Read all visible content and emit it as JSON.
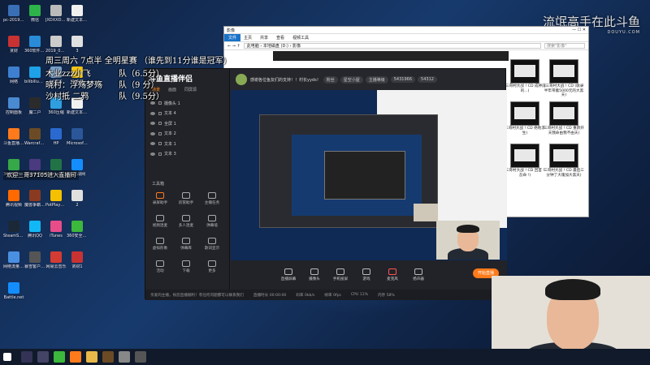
{
  "desktop_icons": [
    {
      "label": "pc-20190...",
      "color": "#3a6fb5"
    },
    {
      "label": "微信",
      "color": "#2db34a"
    },
    {
      "label": "JXDXXDR...",
      "color": "#bbbbbb"
    },
    {
      "label": "新建文本文档 (2)",
      "color": "#f0f0f0"
    },
    {
      "label": "贪财",
      "color": "#c83232"
    },
    {
      "label": "360软件管家",
      "color": "#2a8bd8"
    },
    {
      "label": "2019_06_1...",
      "color": "#cccccc"
    },
    {
      "label": "3",
      "color": "#e0e0e0"
    },
    {
      "label": "网络",
      "color": "#3f7fcf"
    },
    {
      "label": "bilibiliupl...",
      "color": "#1ea1e6"
    },
    {
      "label": "回收站",
      "color": "#7aa0c8"
    },
    {
      "label": "YY语音",
      "color": "#f2c316"
    },
    {
      "label": "控制面板",
      "color": "#4a8ad0"
    },
    {
      "label": "魔二户",
      "color": "#2b2b2b"
    },
    {
      "label": "360压缩",
      "color": "#2f9fe0"
    },
    {
      "label": "新建文本文档",
      "color": "#f0f0f0"
    },
    {
      "label": "斗鱼直播伴侣",
      "color": "#ff7a1a"
    },
    {
      "label": "Warcraft III",
      "color": "#6b4b25"
    },
    {
      "label": "HP",
      "color": "#2a6ad0"
    },
    {
      "label": "Microsoft Office Wo...",
      "color": "#2b579a"
    },
    {
      "label": "360安全浏览器",
      "color": "#36a848"
    },
    {
      "label": "魔兽争霸III",
      "color": "#4a3a80"
    },
    {
      "label": "Microsoft Office Exc...",
      "color": "#217346"
    },
    {
      "label": "暴雪战网",
      "color": "#148eff"
    },
    {
      "label": "腾讯视频",
      "color": "#ff6a00"
    },
    {
      "label": "魔兽争霸官方对战平台",
      "color": "#8a3a20"
    },
    {
      "label": "PotPlayer 64 bit",
      "color": "#f4c000"
    },
    {
      "label": "2",
      "color": "#e0e0e0"
    },
    {
      "label": "SteamSetup",
      "color": "#1b2838"
    },
    {
      "label": "腾讯QQ",
      "color": "#12b7f5"
    },
    {
      "label": "iTunes",
      "color": "#e84d8a"
    },
    {
      "label": "360安全卫士",
      "color": "#3cb83c"
    },
    {
      "label": "网络流量监控器",
      "color": "#4a90e2"
    },
    {
      "label": "暴雪客户7.0",
      "color": "#555555"
    },
    {
      "label": "网易云音乐",
      "color": "#d43c33"
    },
    {
      "label": "贪财1",
      "color": "#c83232"
    },
    {
      "label": "Battle.net",
      "color": "#148eff"
    }
  ],
  "watermark": {
    "text": "流氓高手在此",
    "logo": "斗鱼",
    "site": "DOUYU.COM"
  },
  "overlay": {
    "line1": "周三周六 7点半 全明星赛 （谁先到11分谁是冠军）",
    "line2": "木业zzz小飞",
    "line2b": "队（6.5分）",
    "line3": "晓村：浮殇梦殇",
    "line3b": "队（9 分）",
    "line4": "沙村抵 二鸦",
    "line4b": "队（9.5分）",
    "welcome": "欢迎三哥37105进入直播间"
  },
  "explorer": {
    "title": "影像",
    "tabs": [
      "文件",
      "主页",
      "共享",
      "查看",
      "视频工具"
    ],
    "path": "此电脑 › 本地磁盘 (D:) › 影像",
    "search_placeholder": "搜索\"影像\"",
    "items": [
      {
        "caption": "(三哥村大战 ! CD 成神前的...)"
      },
      {
        "caption": "(三哥村大战 ! CD (收录半年带着5000元的大黑天)"
      },
      {
        "caption": "三哥村大战 ! CD 绝地求生)"
      },
      {
        "caption": "三哥村大战 ! CD 重新开天我命由我不由天)"
      },
      {
        "caption": "三哥村大战 ! CD 回首 ! 吾命 !)"
      },
      {
        "caption": "三哥村大战 ! CD 最后三分钟了大魂加大黑天)"
      }
    ]
  },
  "companion": {
    "logo": "斗鱼直播伴侣",
    "tabs": [
      "场景",
      "画面",
      "同屏源"
    ],
    "sources": [
      "摄像头 1",
      "文本 4",
      "全屏 1",
      "文本 2",
      "文本 1",
      "文本 3"
    ],
    "tools_title": "工具箱",
    "tools": [
      "录屏助手",
      "房管助手",
      "主播任务",
      "视频连麦",
      "多人连麦",
      "弹幕墙",
      "虚拟形象",
      "弹幕库",
      "歌词显示",
      "活动",
      "下载",
      "更多"
    ],
    "header_title": "感谢各位鱼友们的支持！！村长yyds！",
    "header_badge": "粉丝",
    "stats": [
      "星空小屋",
      "主播等级",
      "5431966",
      "54312"
    ],
    "bottom_buttons": [
      "直播屏幕",
      "摄像头",
      "手机投屏",
      "游戏",
      "麦克风",
      "扬声器"
    ],
    "start_label": "开始直播",
    "status": [
      "直播时长 00:00:00",
      "码率 0kb/s",
      "帧率 0fps",
      "CPU 11%",
      "内存 58%"
    ],
    "footer_tip": "亲爱的主播，祝您直播顺利！有任何问题都可以联系我们"
  }
}
